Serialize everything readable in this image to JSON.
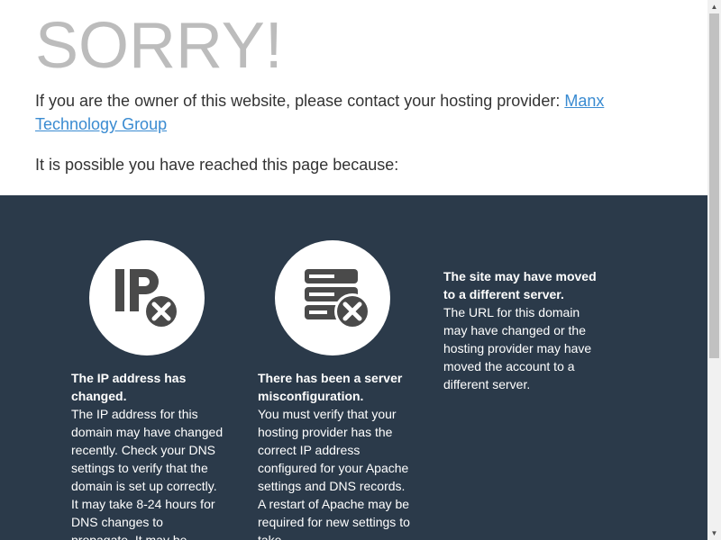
{
  "header": {
    "headline": "SORRY!",
    "owner_text": "If you are the owner of this website, please contact your hosting provider: ",
    "owner_link": "Manx Technology Group",
    "reason_text": "It is possible you have reached this page because:"
  },
  "reasons": [
    {
      "icon": "ip-error-icon",
      "title": "The IP address has changed.",
      "body": "The IP address for this domain may have changed recently. Check your DNS settings to verify that the domain is set up correctly. It may take 8-24 hours for DNS changes to propagate. It may be"
    },
    {
      "icon": "server-error-icon",
      "title": "There has been a server misconfiguration.",
      "body": "You must verify that your hosting provider has the correct IP address configured for your Apache settings and DNS records. A restart of Apache may be required for new settings to take"
    },
    {
      "title": "The site may have moved to a different server.",
      "body": "The URL for this domain may have changed or the hosting provider may have moved the account to a different server."
    }
  ],
  "colors": {
    "headline": "#bcbcbc",
    "link": "#3a8bd1",
    "panel_background": "#2b3a4a",
    "icon_dark": "#4a4a4a"
  }
}
